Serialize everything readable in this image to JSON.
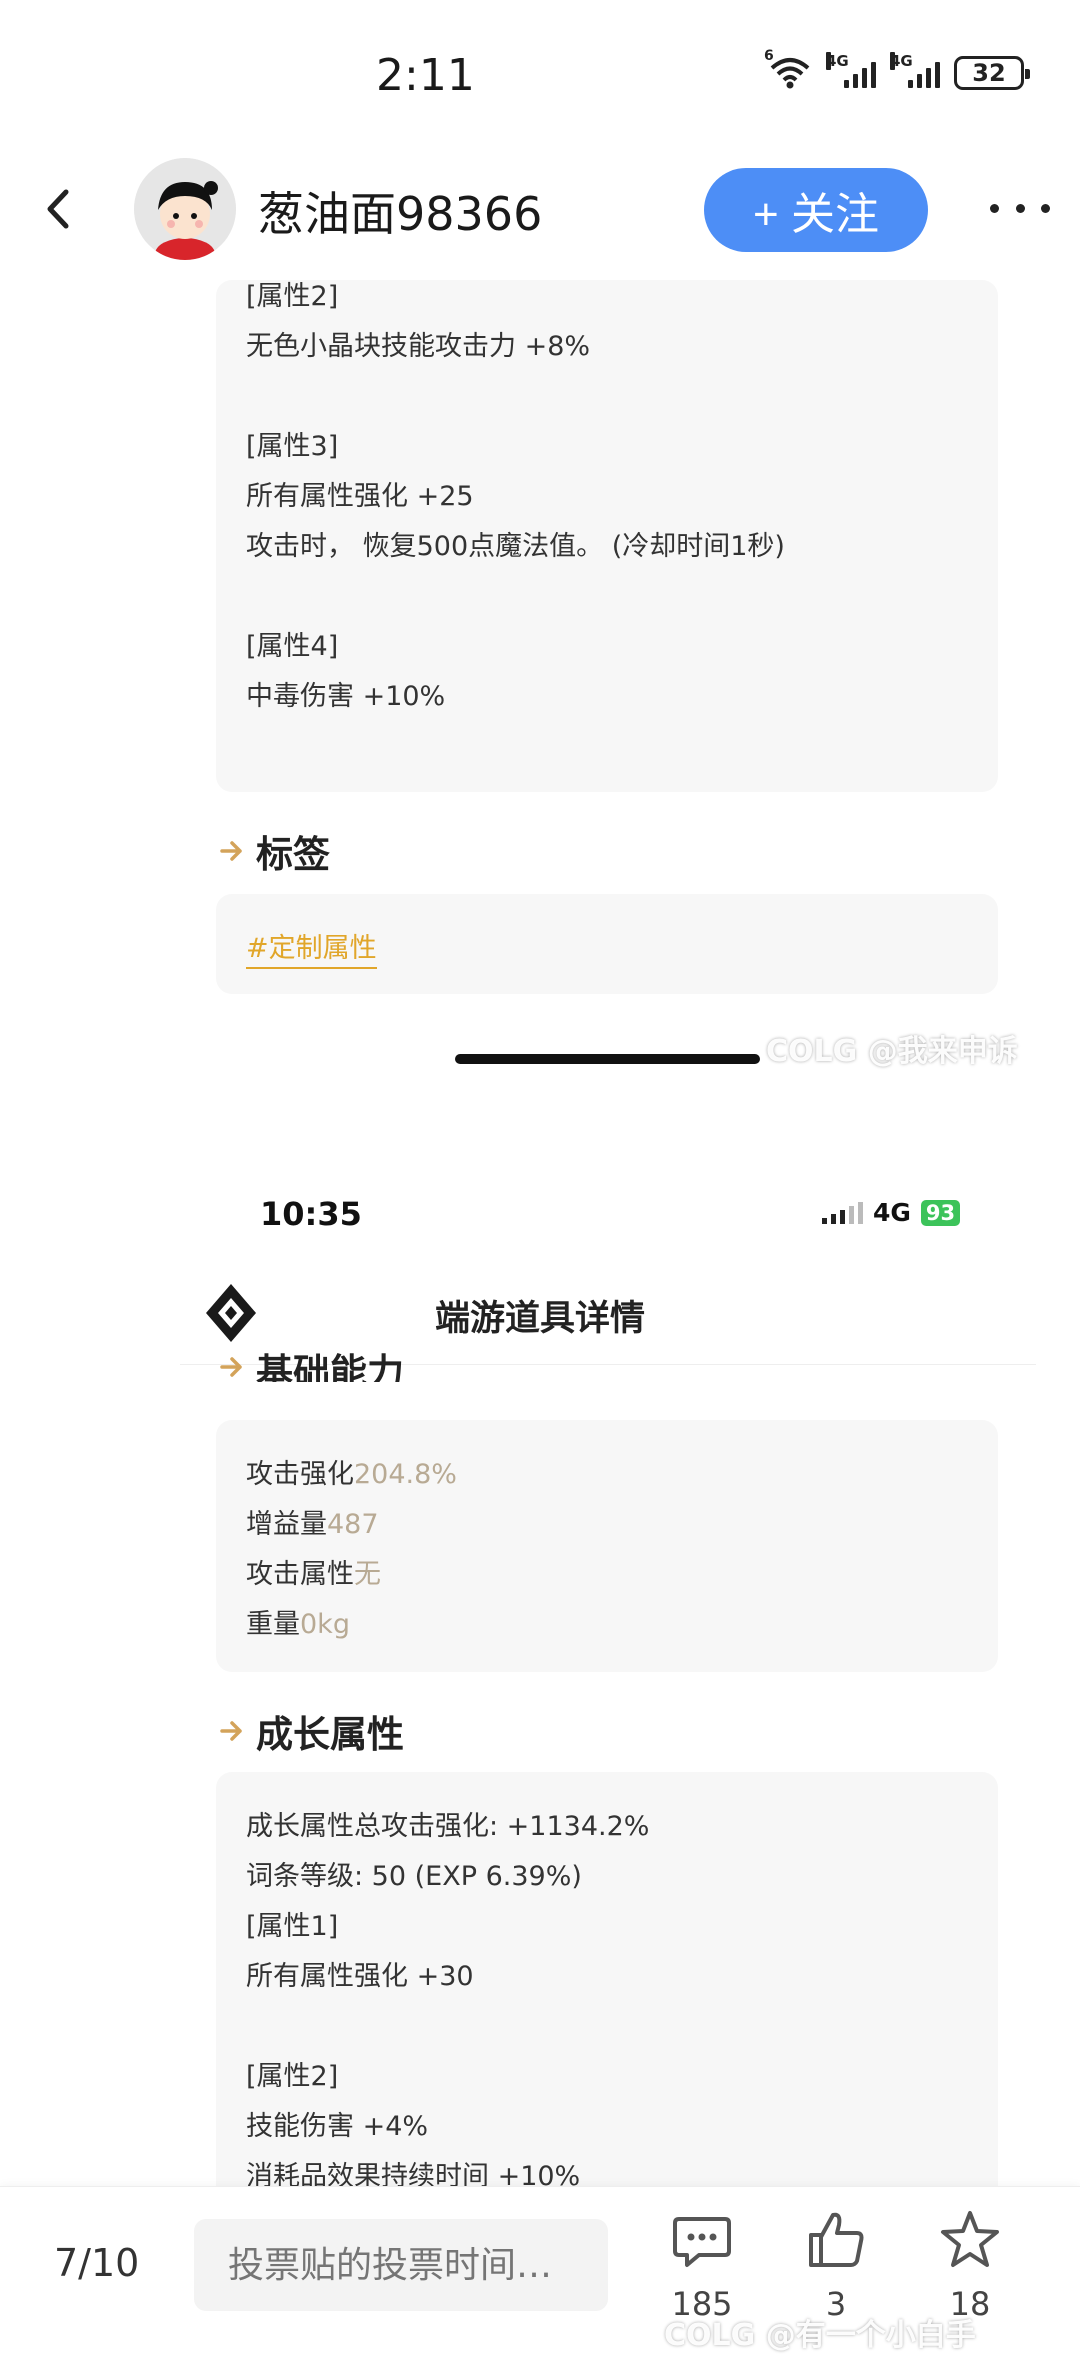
{
  "status_bar": {
    "time": "2:11",
    "signal1": "4G",
    "signal2": "4G",
    "wifi_level": "6",
    "battery": "32"
  },
  "header": {
    "username": "葱油面98366",
    "follow_label": "+ 关注"
  },
  "post": {
    "top_card_lines": [
      "[属性2]",
      "无色小晶块技能攻击力 +8%",
      "[属性3]",
      "所有属性强化 +25",
      "攻击时， 恢复500点魔法值。 (冷却时间1秒)",
      "[属性4]",
      "中毒伤害 +10%"
    ],
    "tags_title": "标签",
    "tag": "#定制属性",
    "watermark1": "COLG @我来申诉"
  },
  "inner": {
    "time": "10:35",
    "network": "4G",
    "battery": "93",
    "title": "端游道具详情",
    "cut_heading": "基础能力",
    "basic": [
      {
        "label": "攻击强化",
        "value": "204.8%"
      },
      {
        "label": "增益量",
        "value": "487"
      },
      {
        "label": "攻击属性",
        "value": "无"
      },
      {
        "label": "重量",
        "value": "0kg"
      }
    ],
    "growth_title": "成长属性",
    "growth_lines": [
      "成长属性总攻击强化: +1134.2%",
      "词条等级: 50 (EXP 6.39%)",
      "[属性1]",
      "所有属性强化 +30",
      "[属性2]",
      "技能伤害 +4%",
      "消耗品效果持续时间 +10%"
    ]
  },
  "bottom": {
    "page": "7/10",
    "vote_placeholder": "投票贴的投票时间…",
    "comments": "185",
    "likes": "3",
    "favorites": "18",
    "watermark2": "COLG @有一个小白手"
  }
}
